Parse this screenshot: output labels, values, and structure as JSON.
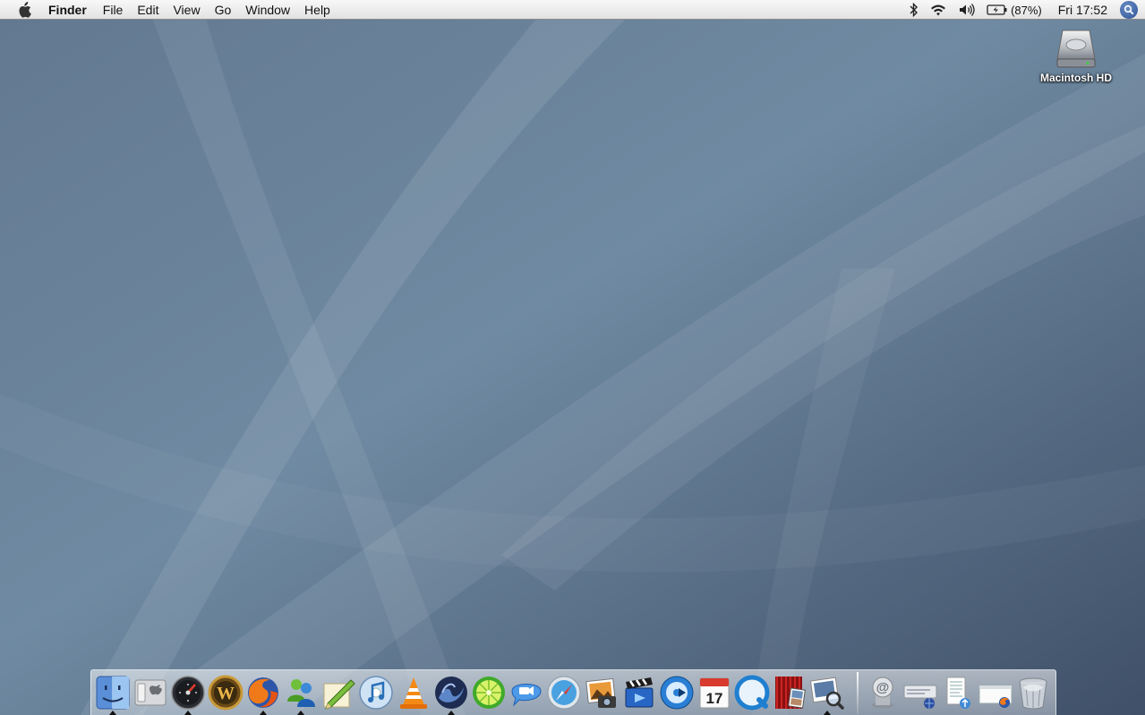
{
  "menubar": {
    "app_name": "Finder",
    "menus": [
      "File",
      "Edit",
      "View",
      "Go",
      "Window",
      "Help"
    ],
    "battery_text": "(87%)",
    "clock": "Fri 17:52",
    "status_icons": [
      "bluetooth-icon",
      "wifi-icon",
      "volume-icon",
      "battery-icon",
      "spotlight-icon"
    ]
  },
  "desktop": {
    "icons": [
      {
        "label": "Macintosh HD",
        "icon": "hard-drive-icon"
      }
    ]
  },
  "dock": {
    "apps": [
      {
        "name": "Finder",
        "icon": "finder-icon",
        "running": true
      },
      {
        "name": "System Preferences",
        "icon": "system-preferences-icon",
        "running": false
      },
      {
        "name": "Dashboard",
        "icon": "dashboard-icon",
        "running": true
      },
      {
        "name": "World of Warcraft",
        "icon": "warcraft-icon",
        "running": false
      },
      {
        "name": "Firefox",
        "icon": "firefox-icon",
        "running": true
      },
      {
        "name": "Messenger",
        "icon": "messenger-icon",
        "running": true
      },
      {
        "name": "Pencil App",
        "icon": "pencil-icon",
        "running": false
      },
      {
        "name": "iTunes",
        "icon": "itunes-icon",
        "running": false
      },
      {
        "name": "VLC",
        "icon": "vlc-icon",
        "running": false
      },
      {
        "name": "Wave App",
        "icon": "wave-icon",
        "running": true
      },
      {
        "name": "LimeWire",
        "icon": "limewire-icon",
        "running": false
      },
      {
        "name": "iChat",
        "icon": "ichat-icon",
        "running": false
      },
      {
        "name": "Safari",
        "icon": "safari-icon",
        "running": false
      },
      {
        "name": "iPhoto",
        "icon": "iphoto-icon",
        "running": false
      },
      {
        "name": "iMovie",
        "icon": "imovie-icon",
        "running": false
      },
      {
        "name": "DVD Player",
        "icon": "dvd-icon",
        "running": false
      },
      {
        "name": "iCal",
        "icon": "ical-icon",
        "running": false,
        "date": "17"
      },
      {
        "name": "QuickTime",
        "icon": "quicktime-icon",
        "running": false
      },
      {
        "name": "Photo Booth",
        "icon": "photobooth-icon",
        "running": false
      },
      {
        "name": "Preview",
        "icon": "preview-icon",
        "running": true
      }
    ],
    "docs": [
      {
        "name": "Mail",
        "icon": "mail-icon"
      },
      {
        "name": "Network Drive",
        "icon": "network-drive-icon"
      },
      {
        "name": "Document",
        "icon": "document-icon"
      },
      {
        "name": "Downloads",
        "icon": "downloads-icon"
      },
      {
        "name": "Trash",
        "icon": "trash-icon"
      }
    ]
  },
  "colors": {
    "menubar_bg": "#ececec",
    "wallpaper_base": "#5f7590",
    "dock_bg": "#dfe3e8"
  }
}
